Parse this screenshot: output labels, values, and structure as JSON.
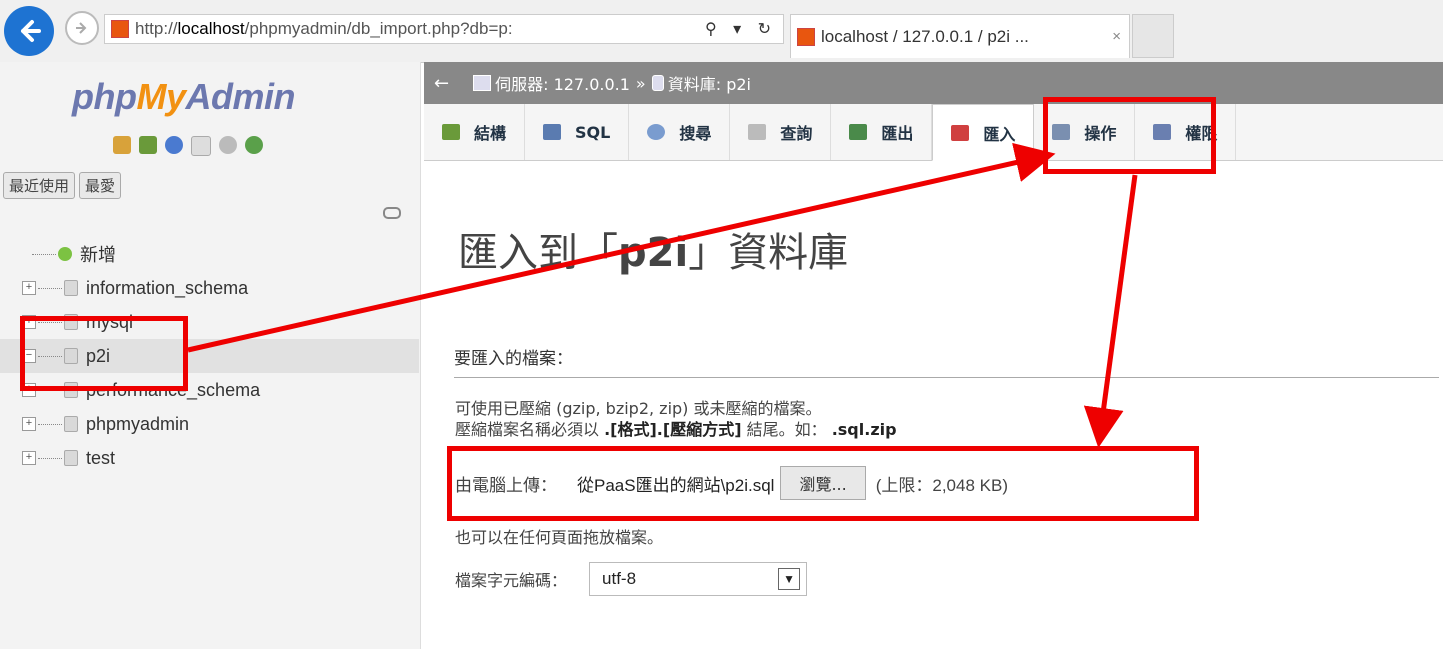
{
  "browser": {
    "url_prefix": "http://",
    "url_host": "localhost",
    "url_path": "/phpmyadmin/db_import.php?db=p:",
    "addr_tools": "⚲ ▾ ↻",
    "tab_title": "localhost / 127.0.0.1 / p2i ...",
    "tab_close": "×"
  },
  "sidebar": {
    "logo_php": "php",
    "logo_my": "My",
    "logo_admin": "Admin",
    "tab_recent": "最近使用",
    "tab_favorite": "最愛",
    "tree": [
      {
        "label": "新增",
        "type": "new"
      },
      {
        "label": "information_schema",
        "type": "db",
        "expander": "+"
      },
      {
        "label": "mysql",
        "type": "db",
        "expander": "+"
      },
      {
        "label": "p2i",
        "type": "db",
        "expander": "−",
        "selected": true
      },
      {
        "label": "performance_schema",
        "type": "db",
        "expander": "+"
      },
      {
        "label": "phpmyadmin",
        "type": "db",
        "expander": "+"
      },
      {
        "label": "test",
        "type": "db",
        "expander": "+"
      }
    ]
  },
  "breadcrumb": {
    "back": "←",
    "server": "伺服器: 127.0.0.1",
    "sep": "»",
    "database": "資料庫: p2i"
  },
  "toptabs": [
    {
      "label": "結構",
      "icon": "structure-icon",
      "color": "#6a9a3a"
    },
    {
      "label": "SQL",
      "icon": "sql-icon",
      "color": "#5a7bb0"
    },
    {
      "label": "搜尋",
      "icon": "search-icon",
      "color": "#7a9ccf"
    },
    {
      "label": "查詢",
      "icon": "query-icon",
      "color": "#aaaaaa"
    },
    {
      "label": "匯出",
      "icon": "export-icon",
      "color": "#4a8a4a"
    },
    {
      "label": "匯入",
      "icon": "import-icon",
      "color": "#d04040",
      "active": true
    },
    {
      "label": "操作",
      "icon": "operations-icon",
      "color": "#7a8fb0"
    },
    {
      "label": "權限",
      "icon": "privileges-icon",
      "color": "#6a7fb0"
    }
  ],
  "main": {
    "heading_pre": "匯入到「",
    "heading_db": "p2i",
    "heading_post": "」資料庫",
    "section_title": "要匯入的檔案：",
    "desc_line1": "可使用已壓縮 (gzip, bzip2, zip) 或未壓縮的檔案。",
    "desc_line2_pre": "壓縮檔案名稱必須以 ",
    "desc_line2_bold": ".[格式].[壓縮方式]",
    "desc_line2_mid": " 結尾。如： ",
    "desc_line2_example": ".sql.zip",
    "upload_label": "由電腦上傳：",
    "upload_value": "從PaaS匯出的網站\\p2i.sql",
    "browse_label": "瀏覽...",
    "upload_limit": "(上限：2,048 KB)",
    "dnd_text": "也可以在任何頁面拖放檔案。",
    "charset_label": "檔案字元編碼：",
    "charset_value": "utf-8"
  },
  "colors": {
    "annotation": "#ee0000",
    "accent": "#1e73d2"
  }
}
